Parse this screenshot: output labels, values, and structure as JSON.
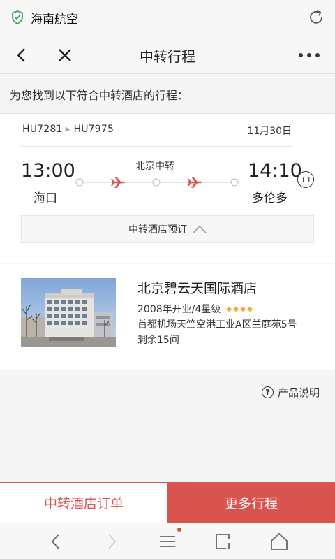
{
  "status": {
    "app_name": "海南航空"
  },
  "nav": {
    "title": "中转行程"
  },
  "intro": "为您找到以下符合中转酒店的行程：",
  "trip": {
    "flight1": "HU7281",
    "flight2": "HU7975",
    "date": "11月30日",
    "dep_time": "13:00",
    "dep_city": "海口",
    "arr_time": "14:10",
    "arr_city": "多伦多",
    "transfer": "北京中转",
    "plus_day": "+1",
    "hotel_book_label": "中转酒店预订",
    "plane_color": "#d9534f"
  },
  "hotel": {
    "name": "北京碧云天国际酒店",
    "meta": "2008年开业/4星级",
    "stars": 4,
    "address": "首都机场天竺空港工业A区兰庭苑5号",
    "rooms": "剩余15间"
  },
  "product_note": "产品说明",
  "bottom": {
    "order_label": "中转酒店订单",
    "more_label": "更多行程",
    "accent": "#d9534f"
  }
}
